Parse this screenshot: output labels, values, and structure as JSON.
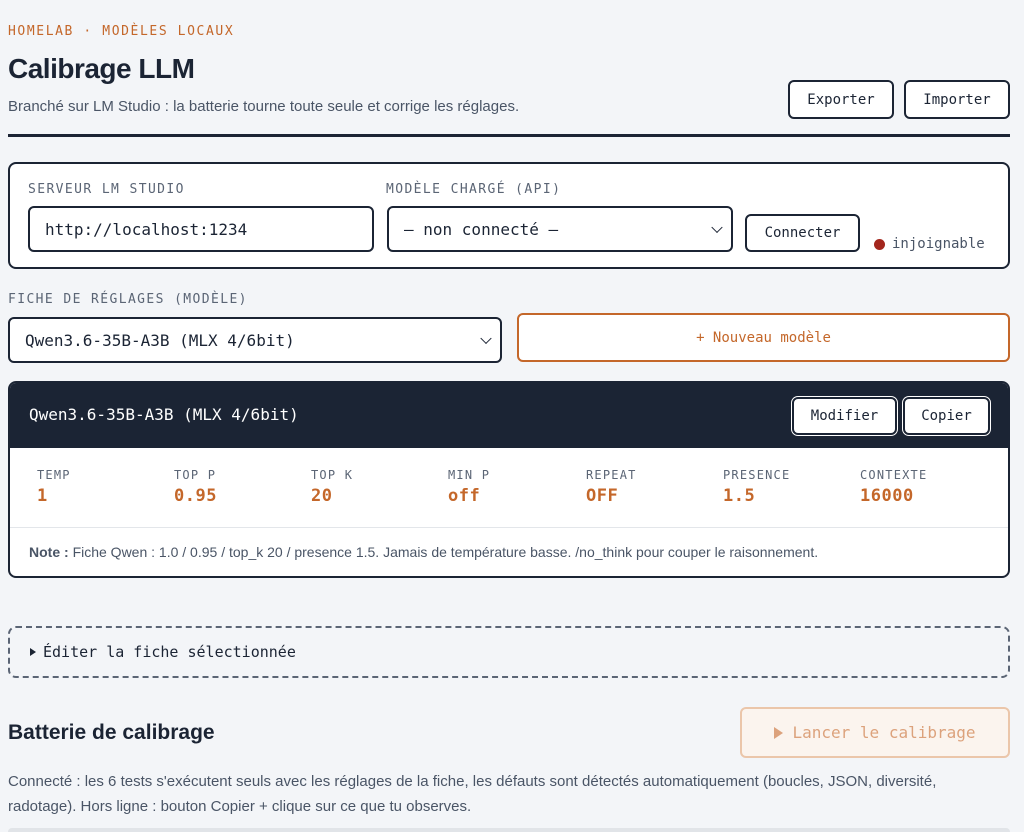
{
  "header": {
    "eyebrow": "HOMELAB · MODÈLES LOCAUX",
    "title": "Calibrage LLM",
    "subtitle": "Branché sur LM Studio : la batterie tourne toute seule et corrige les réglages.",
    "export_label": "Exporter",
    "import_label": "Importer"
  },
  "server": {
    "label": "SERVEUR LM STUDIO",
    "url": "http://localhost:1234",
    "model_label": "MODÈLE CHARGÉ (API)",
    "model_value": "— non connecté —",
    "connect_label": "Connecter",
    "status_text": "injoignable",
    "status_color": "#a3261d"
  },
  "profile_select": {
    "label": "FICHE DE RÉGLAGES (MODÈLE)",
    "selected": "Qwen3.6-35B-A3B (MLX 4/6bit)",
    "new_label": "+ Nouveau modèle"
  },
  "profile": {
    "name": "Qwen3.6-35B-A3B (MLX 4/6bit)",
    "edit_label": "Modifier",
    "copy_label": "Copier",
    "params": [
      {
        "label": "TEMP",
        "value": "1"
      },
      {
        "label": "TOP P",
        "value": "0.95"
      },
      {
        "label": "TOP K",
        "value": "20"
      },
      {
        "label": "MIN P",
        "value": "off"
      },
      {
        "label": "REPEAT",
        "value": "OFF"
      },
      {
        "label": "PRESENCE",
        "value": "1.5"
      },
      {
        "label": "CONTEXTE",
        "value": "16000"
      }
    ],
    "note_label": "Note :",
    "note_text": "Fiche Qwen : 1.0 / 0.95 / top_k 20 / presence 1.5. Jamais de température basse. /no_think pour couper le raisonnement."
  },
  "editor": {
    "label": "Éditer la fiche sélectionnée"
  },
  "battery": {
    "title": "Batterie de calibrage",
    "run_label": "Lancer le calibrage",
    "description": "Connecté : les 6 tests s'exécutent seuls avec les réglages de la fiche, les défauts sont détectés automatiquement (boucles, JSON, diversité, radotage). Hors ligne : bouton Copier + clique sur ce que tu observes."
  },
  "colors": {
    "accent": "#c4672a",
    "ink": "#1b2434",
    "background": "#f3f5f8"
  }
}
